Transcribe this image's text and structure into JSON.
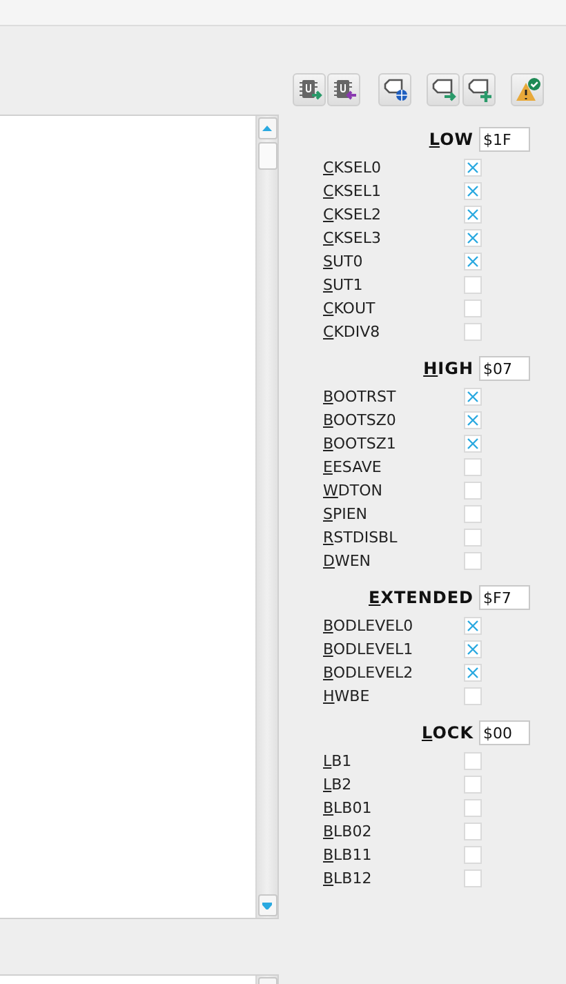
{
  "toolbar": [
    {
      "kind": "chip-out"
    },
    {
      "kind": "chip-in"
    },
    {
      "kind": "tag-globe"
    },
    {
      "kind": "tag-out"
    },
    {
      "kind": "tag-add"
    },
    {
      "kind": "warn-check"
    }
  ],
  "fuse_groups": [
    {
      "title": "LOW",
      "value": "$1F",
      "bits": [
        {
          "label": "CKSEL0",
          "checked": true
        },
        {
          "label": "CKSEL1",
          "checked": true
        },
        {
          "label": "CKSEL2",
          "checked": true
        },
        {
          "label": "CKSEL3",
          "checked": true
        },
        {
          "label": "SUT0",
          "checked": true
        },
        {
          "label": "SUT1",
          "checked": false
        },
        {
          "label": "CKOUT",
          "checked": false
        },
        {
          "label": "CKDIV8",
          "checked": false
        }
      ]
    },
    {
      "title": "HIGH",
      "value": "$07",
      "bits": [
        {
          "label": "BOOTRST",
          "checked": true
        },
        {
          "label": "BOOTSZ0",
          "checked": true
        },
        {
          "label": "BOOTSZ1",
          "checked": true
        },
        {
          "label": "EESAVE",
          "checked": false
        },
        {
          "label": "WDTON",
          "checked": false
        },
        {
          "label": "SPIEN",
          "checked": false
        },
        {
          "label": "RSTDISBL",
          "checked": false
        },
        {
          "label": "DWEN",
          "checked": false
        }
      ]
    },
    {
      "title": "EXTENDED",
      "value": "$F7",
      "bits": [
        {
          "label": "BODLEVEL0",
          "checked": true
        },
        {
          "label": "BODLEVEL1",
          "checked": true
        },
        {
          "label": "BODLEVEL2",
          "checked": true
        },
        {
          "label": "HWBE",
          "checked": false
        }
      ]
    },
    {
      "title": "LOCK",
      "value": "$00",
      "bits": [
        {
          "label": "LB1",
          "checked": false
        },
        {
          "label": "LB2",
          "checked": false
        },
        {
          "label": "BLB01",
          "checked": false
        },
        {
          "label": "BLB02",
          "checked": false
        },
        {
          "label": "BLB11",
          "checked": false
        },
        {
          "label": "BLB12",
          "checked": false
        }
      ]
    }
  ]
}
